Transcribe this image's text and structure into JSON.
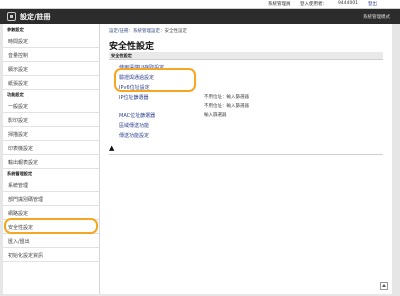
{
  "topbar": {
    "login_user": "系統管理員",
    "user_label": "登入使用者：",
    "user_name": "9444001",
    "logout": "登出"
  },
  "header": {
    "app_title": "設定/註冊",
    "link": "系統管理模式"
  },
  "sidebar": {
    "sections": [
      {
        "title": "參數設定",
        "items": [
          "時間設定",
          "音量控制",
          "顯示設定",
          "紙張設定"
        ]
      },
      {
        "title": "功能設定",
        "items": [
          "一般設定",
          "影印設定",
          "掃描設定",
          "印表機設定",
          "輸出報表設定"
        ]
      },
      {
        "title": "系統管理設定",
        "items": [
          "系統管理",
          "部門識別碼管理",
          "網路設定",
          "安全性設定",
          "匯入/匯出",
          "初始化設定資訊"
        ]
      }
    ]
  },
  "main": {
    "breadcrumb": [
      "設定/註冊",
      "系統管理設定",
      "安全性設定"
    ],
    "breadcrumb_sep": "：",
    "title": "安全性設定",
    "section_title": "安全性設定",
    "links": [
      "使用遠端UI存取設定",
      "驗證與通過設定",
      "IPv6位址設定",
      "IP位址篩選器",
      "MAC位址篩選器",
      "區域傳送功能",
      "傳送功能設定"
    ],
    "values": {
      "ip_filter_1": "不用位址：輸入篩選器",
      "ip_filter_2": "不用位址：輸入篩選器",
      "mac_filter": "輸入篩選器"
    },
    "back_to_top": "▲"
  },
  "highlight_color": "#f5a623"
}
